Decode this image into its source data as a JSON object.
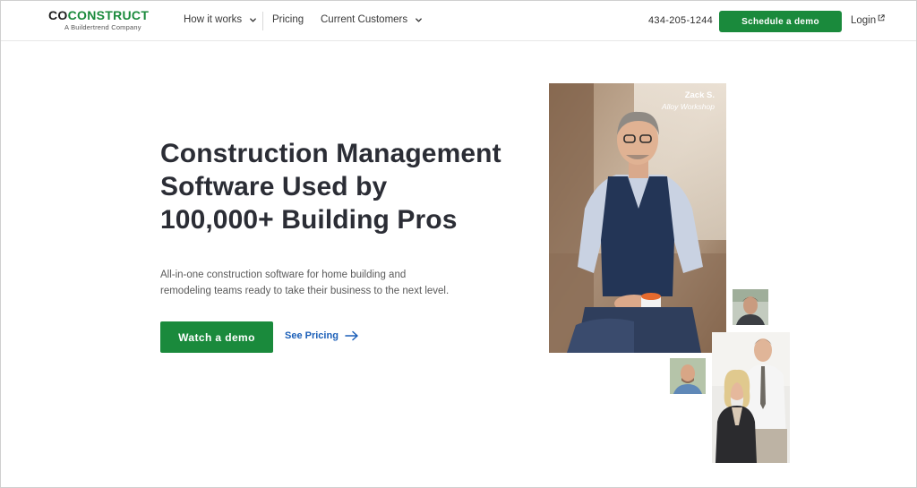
{
  "header": {
    "logo_co": "CO",
    "logo_construct": "CONSTRUCT",
    "logo_tagline": "A Buildertrend Company",
    "nav": [
      {
        "label": "How it works",
        "has_dropdown": true
      },
      {
        "label": "Pricing",
        "has_dropdown": false
      },
      {
        "label": "Current Customers",
        "has_dropdown": true
      }
    ],
    "phone": "434-205-1244",
    "schedule_label": "Schedule a demo",
    "login_label": "Login"
  },
  "hero": {
    "title_line1": "Construction Management",
    "title_line2": "Software Used by",
    "title_line3": "100,000+ Building Pros",
    "subtitle_line1": "All-in-one construction software for home building and",
    "subtitle_line2": "remodeling teams ready to take their business to the next level.",
    "watch_demo_label": "Watch a demo",
    "see_pricing_label": "See Pricing"
  },
  "testimonial_photo": {
    "name": "Zack S.",
    "company": "Alloy Workshop"
  },
  "icons": {
    "nav_dropdown": "chevron-down-icon",
    "login": "external-link-icon",
    "pricing_link": "arrow-right-icon"
  },
  "colors": {
    "brand_green": "#1a8a3c",
    "link_blue": "#1b5fb8",
    "heading": "#2b2d35"
  }
}
